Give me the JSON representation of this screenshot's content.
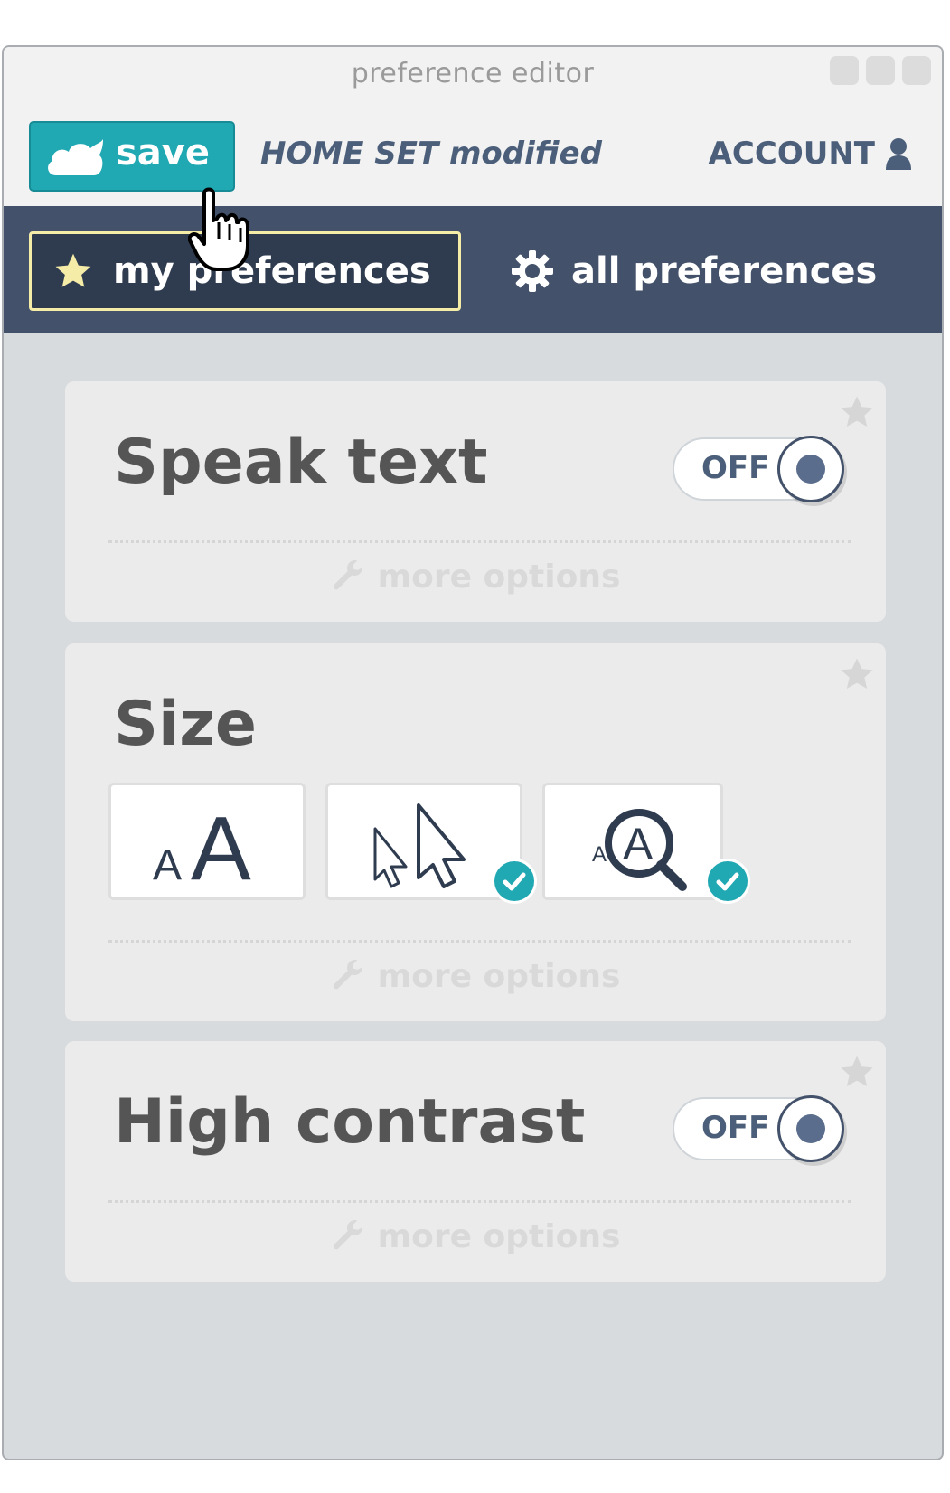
{
  "window": {
    "title": "preference editor"
  },
  "header": {
    "save_label": "save",
    "status": "HOME SET modified",
    "account_label": "ACCOUNT"
  },
  "tabs": [
    {
      "label": "my preferences",
      "active": true,
      "icon": "star-icon"
    },
    {
      "label": "all preferences",
      "active": false,
      "icon": "gear-icon"
    }
  ],
  "cards": {
    "speak_text": {
      "title": "Speak text",
      "toggle": "OFF",
      "more": "more options"
    },
    "size": {
      "title": "Size",
      "options": [
        {
          "name": "text-size",
          "checked": false
        },
        {
          "name": "cursor-size",
          "checked": true
        },
        {
          "name": "magnifier",
          "checked": true
        }
      ],
      "more": "more options"
    },
    "high_contrast": {
      "title": "High contrast",
      "toggle": "OFF",
      "more": "more options"
    }
  },
  "colors": {
    "accent": "#20a8b3",
    "tabbar": "#43526a",
    "text_primary": "#555555",
    "header_text": "#4c5f7a"
  }
}
